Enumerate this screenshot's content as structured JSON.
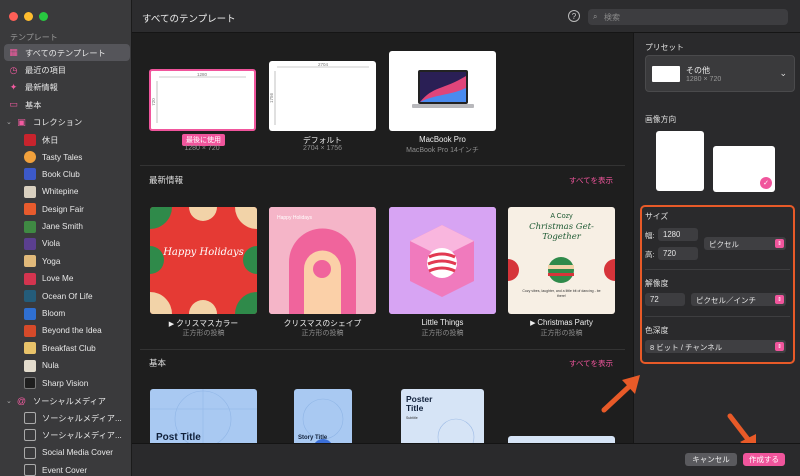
{
  "window": {
    "title": "すべてのテンプレート"
  },
  "search": {
    "placeholder": "検索"
  },
  "sidebar": {
    "section_label": "テンプレート",
    "items": [
      {
        "label": "すべてのテンプレート",
        "icon": "grid-icon",
        "selected": true
      },
      {
        "label": "最近の項目",
        "icon": "clock-icon"
      },
      {
        "label": "最新情報",
        "icon": "sparkle-icon"
      },
      {
        "label": "基本",
        "icon": "square-icon"
      },
      {
        "label": "コレクション",
        "icon": "collection-icon"
      },
      {
        "label": "休日"
      },
      {
        "label": "Tasty Tales"
      },
      {
        "label": "Book Club"
      },
      {
        "label": "Whitepine"
      },
      {
        "label": "Design Fair"
      },
      {
        "label": "Jane Smith"
      },
      {
        "label": "Viola"
      },
      {
        "label": "Yoga"
      },
      {
        "label": "Love Me"
      },
      {
        "label": "Ocean Of Life"
      },
      {
        "label": "Bloom"
      },
      {
        "label": "Beyond the Idea"
      },
      {
        "label": "Breakfast Club"
      },
      {
        "label": "Nula"
      },
      {
        "label": "Sharp Vision"
      },
      {
        "label": "ソーシャルメディア",
        "icon": "at-icon"
      },
      {
        "label": "ソーシャルメディア..."
      },
      {
        "label": "ソーシャルメディア..."
      },
      {
        "label": "Social Media Cover"
      },
      {
        "label": "Event Cover"
      }
    ]
  },
  "recent": {
    "items": [
      {
        "badge": "最後に使用",
        "sub": "1280 × 720",
        "w": "1280",
        "h": "720"
      },
      {
        "title": "デフォルト",
        "sub": "2704 × 1756",
        "w": "2704",
        "h": "1756"
      },
      {
        "title": "MacBook Pro",
        "sub": "MacBook Pro 14インチ"
      }
    ]
  },
  "news": {
    "title": "最新情報",
    "show_all": "すべてを表示",
    "items": [
      {
        "title": "クリスマスカラー",
        "sub": "正方形の投稿",
        "card_text": "Happy Holidays"
      },
      {
        "title": "クリスマスのシェイプ",
        "sub": "正方形の投稿",
        "card_text": "Happy Holidays"
      },
      {
        "title": "Little Things",
        "sub": "正方形の投稿"
      },
      {
        "title": "Christmas Party",
        "sub": "正方形の投稿",
        "card_text_small": "A Cozy",
        "card_text_big": "Christmas Get-Together",
        "card_text_foot": "Cozy vibes, laughter, and a little bit of dancing - be there!"
      }
    ]
  },
  "basic": {
    "title": "基本",
    "show_all": "すべてを表示",
    "items": [
      {
        "card_text": "Post Title"
      },
      {
        "card_text": "Story Title"
      },
      {
        "card_text": "Poster Title",
        "card_sub": "Subtitle"
      },
      {}
    ]
  },
  "panel": {
    "preset_label": "プリセット",
    "preset_name": "その他",
    "preset_size": "1280 × 720",
    "orientation_label": "画像方向",
    "size_label": "サイズ",
    "width_label": "幅:",
    "width_value": "1280",
    "height_label": "高:",
    "height_value": "720",
    "unit": "ピクセル",
    "resolution_label": "解像度",
    "resolution_value": "72",
    "resolution_unit": "ピクセル／インチ",
    "depth_label": "色深度",
    "depth_value": "8 ビット / チャンネル"
  },
  "footer": {
    "cancel": "キャンセル",
    "create": "作成する"
  }
}
